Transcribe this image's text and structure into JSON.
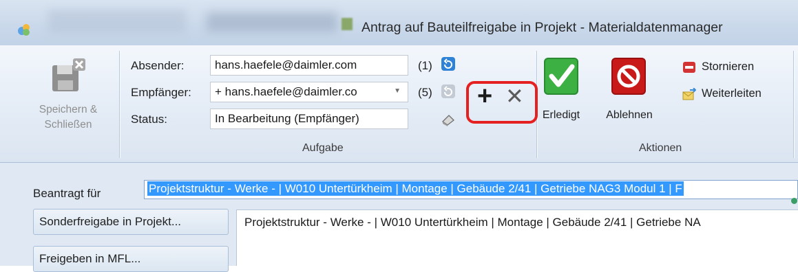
{
  "window": {
    "title": "Antrag auf Bauteilfreigabe in Projekt - Materialdatenmanager"
  },
  "ribbon": {
    "save_close_label_line1": "Speichern &",
    "save_close_label_line2": "Schließen",
    "aufgabe": {
      "group_label": "Aufgabe",
      "absender_label": "Absender:",
      "absender_value": "hans.haefele@daimler.com",
      "absender_count": "(1)",
      "empfaenger_label": "Empfänger:",
      "empfaenger_value": "+ hans.haefele@daimler.co",
      "empfaenger_count": "(5)",
      "status_label": "Status:",
      "status_value": "In Bearbeitung (Empfänger)",
      "add_glyph": "+",
      "remove_glyph": "✕"
    },
    "aktionen": {
      "group_label": "Aktionen",
      "erledigt_label": "Erledigt",
      "ablehnen_label": "Ablehnen",
      "stornieren_label": "Stornieren",
      "weiterleiten_label": "Weiterleiten"
    },
    "highlight_color": "#e52020"
  },
  "content": {
    "beantragt_label": "Beantragt für",
    "beantragt_value": "Projektstruktur - Werke - | W010 Untertürkheim | Montage | Gebäude 2/41 | Getriebe NAG3 Modul 1 | F",
    "buttons": [
      "Sonderfreigabe in Projekt...",
      "Freigeben in MFL..."
    ],
    "detail_text": "Projektstruktur - Werke - | W010 Untertürkheim | Montage | Gebäude 2/41 | Getriebe NA"
  },
  "icons": [
    "app-icon",
    "save-disk-icon",
    "refresh-icon",
    "book-icon",
    "plus-icon",
    "close-icon",
    "checkmark-icon",
    "no-entry-icon",
    "cancel-icon",
    "forward-mail-icon"
  ],
  "colors": {
    "accent": "#3399ff",
    "erledigt": "#3cb043",
    "ablehnen": "#c91a1a"
  }
}
